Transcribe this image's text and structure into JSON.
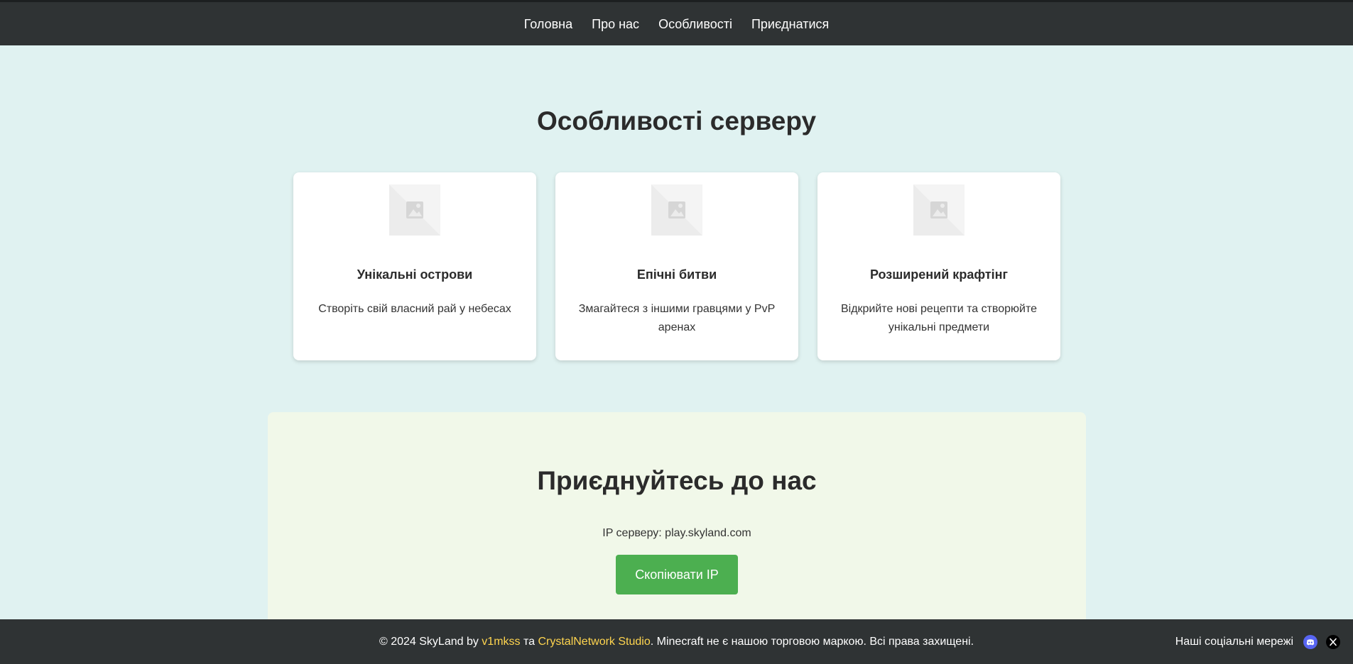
{
  "nav": {
    "items": [
      {
        "label": "Головна"
      },
      {
        "label": "Про нас"
      },
      {
        "label": "Особливості"
      },
      {
        "label": "Приєднатися"
      }
    ]
  },
  "features": {
    "title": "Особливості серверу",
    "cards": [
      {
        "title": "Унікальні острови",
        "text": "Створіть свій власний рай у небесах"
      },
      {
        "title": "Епічні битви",
        "text": "Змагайтеся з іншими гравцями у PvP аренах"
      },
      {
        "title": "Розширений крафтінг",
        "text": "Відкрийте нові рецепти та створюйте унікальні предмети"
      }
    ]
  },
  "join": {
    "title": "Приєднуйтесь до нас",
    "ip_text": "IP серверу: play.skyland.com",
    "copy_button": "Скопіювати IP"
  },
  "footer": {
    "copy_prefix": "© 2024 SkyLand by ",
    "author1": "v1mkss",
    "and": " та ",
    "author2": "CrystalNetwork Studio",
    "copy_suffix": ". Minecraft не є нашою торговою маркою. Всі права захищені.",
    "social_label": "Наші соціальні мережі",
    "social_icons": [
      "discord-icon",
      "x-icon"
    ]
  },
  "colors": {
    "nav_bg": "#2f3334",
    "page_bg": "#e0f2f1",
    "join_bg": "#f1f8e9",
    "button": "#4caf50",
    "footer_link": "#ffd54f"
  }
}
